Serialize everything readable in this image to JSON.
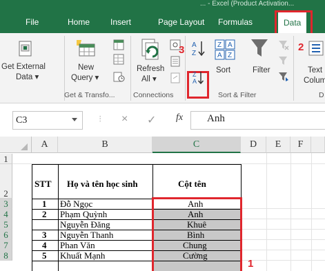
{
  "window": {
    "title": "... - Excel (Product Activation..."
  },
  "tabs": [
    {
      "label": "File",
      "active": false
    },
    {
      "label": "Home",
      "active": false
    },
    {
      "label": "Insert",
      "active": false
    },
    {
      "label": "Page Layout",
      "active": false
    },
    {
      "label": "Formulas",
      "active": false
    },
    {
      "label": "Data",
      "active": true
    }
  ],
  "ribbon": {
    "get_external_line1": "Get External",
    "get_external_line2": "Data ▾",
    "new_query_line1": "New",
    "new_query_line2": "Query ▾",
    "refresh_line1": "Refresh",
    "refresh_line2": "All ▾",
    "sort_label": "Sort",
    "filter_label": "Filter",
    "text_to_columns_line1": "Text",
    "text_to_columns_line2": "Colum",
    "groups": {
      "get_transform": "Get & Transfo...",
      "connections": "Connections",
      "sort_filter": "Sort & Filter",
      "data_tools": "D"
    },
    "sort_az_text": "A↓Z",
    "sort_za_text": "Z↓A"
  },
  "annotations": {
    "step1": "1",
    "step2": "2",
    "step3": "3"
  },
  "formula_bar": {
    "name_box": "C3",
    "cancel_symbol": "×",
    "enter_symbol": "✓",
    "fx_symbol": "fx",
    "value": "Anh"
  },
  "columns": [
    "A",
    "B",
    "C",
    "D",
    "E",
    "F"
  ],
  "rows": [
    "1",
    "2",
    "3",
    "4",
    "5",
    "6",
    "7",
    "8"
  ],
  "table": {
    "header": {
      "stt": "STT",
      "name": "Họ và tên học sinh",
      "col": "Cột tên"
    },
    "rows": [
      {
        "stt": "1",
        "name": "Đỗ Ngọc",
        "col": "Anh"
      },
      {
        "stt": "2",
        "name": "Phạm Quỳnh",
        "col": "Anh"
      },
      {
        "stt": "",
        "name": "Nguyễn Đăng",
        "col": "Khuê"
      },
      {
        "stt": "3",
        "name": "Nguyễn Thanh",
        "col": "Bình"
      },
      {
        "stt": "4",
        "name": "Phan Văn",
        "col": "Chung"
      },
      {
        "stt": "5",
        "name": "Khuất Mạnh",
        "col": "Cường"
      }
    ]
  }
}
